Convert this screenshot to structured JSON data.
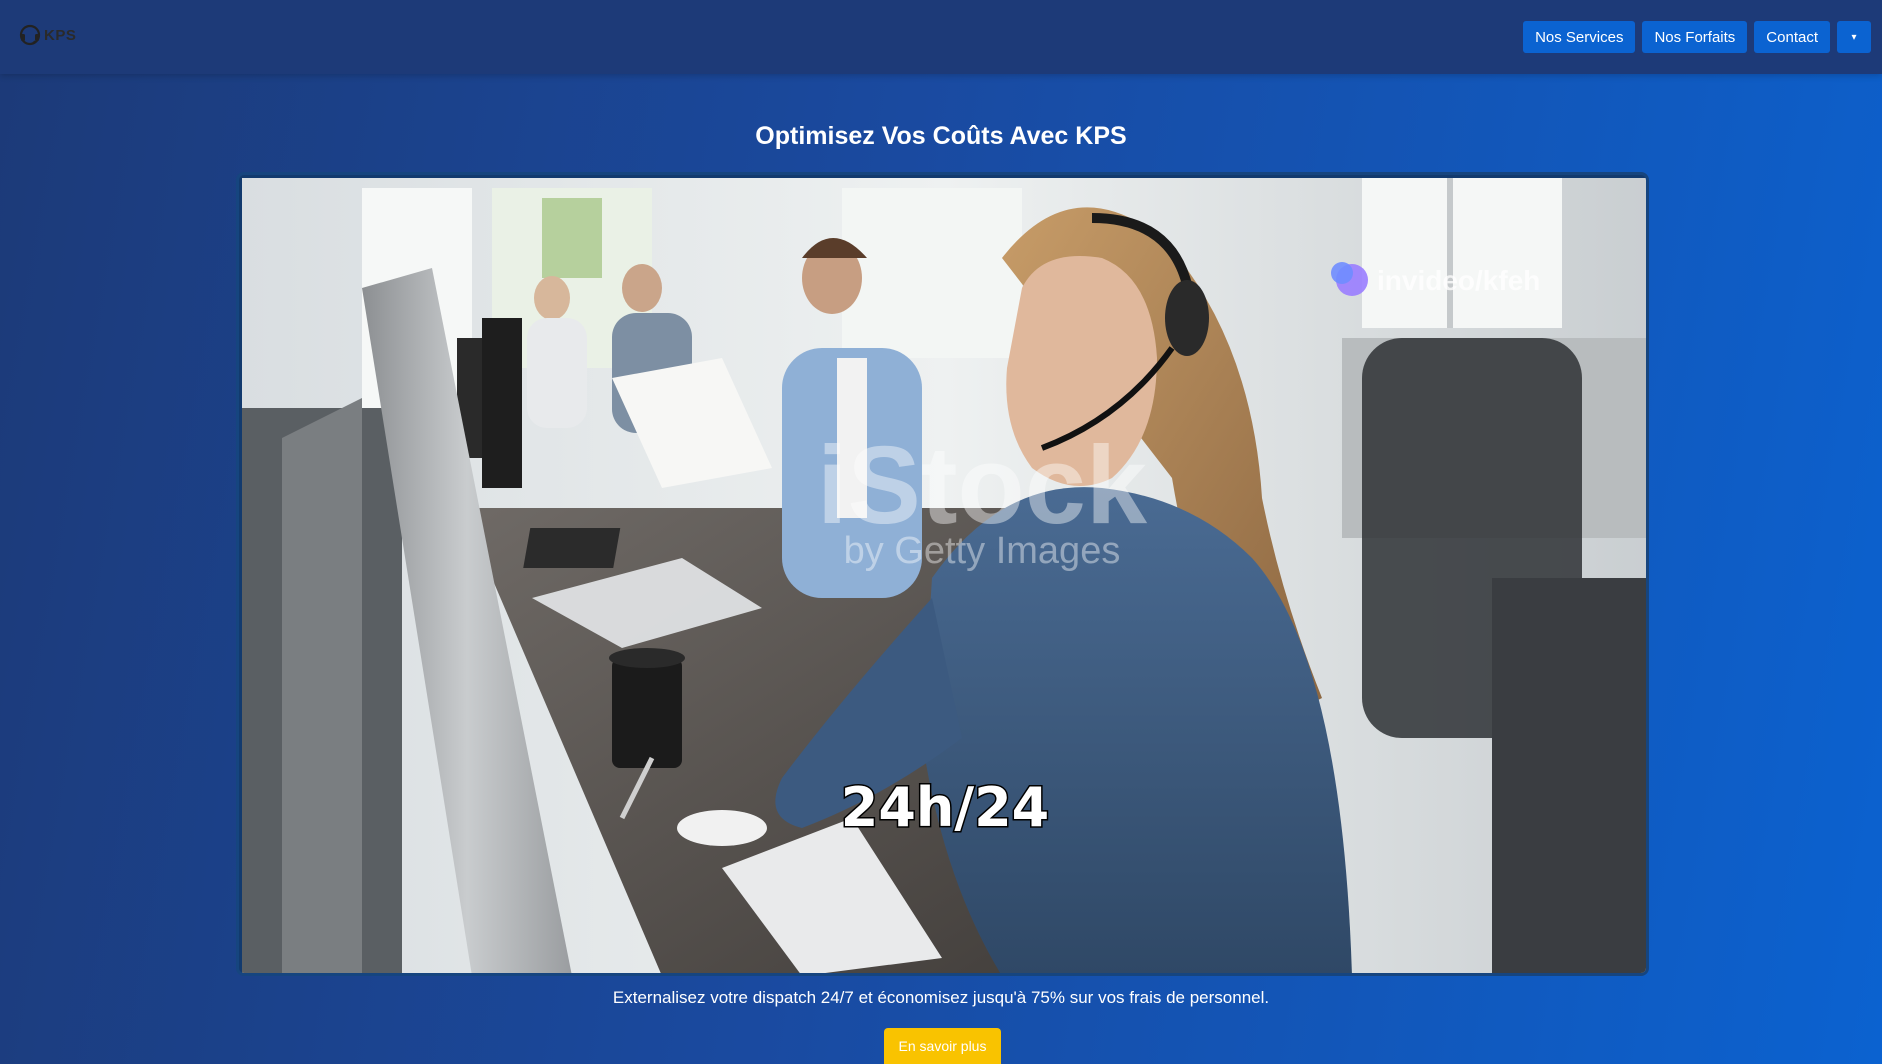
{
  "brand": {
    "logo_text": "KPS"
  },
  "nav": {
    "items": [
      {
        "label": "Nos Services"
      },
      {
        "label": "Nos Forfaits"
      },
      {
        "label": "Contact"
      }
    ],
    "dropdown_glyph": "▾"
  },
  "hero": {
    "title": "Optimisez Vos Coûts Avec KPS",
    "video": {
      "watermark_main": "iStock",
      "watermark_sub": "by Getty Images",
      "corner_tag": "invideo/kfeh",
      "overlay_caption": "24h/24"
    },
    "caption": "Externalisez votre dispatch 24/7 et économisez jusqu'à 75% sur vos frais de personnel.",
    "cta_label": "En savoir plus"
  },
  "colors": {
    "header_bg": "#1d3a78",
    "nav_button": "#0b63d1",
    "cta": "#f9c300"
  },
  "icons": {
    "logo": "headset-icon",
    "dropdown": "chevron-down-icon"
  }
}
